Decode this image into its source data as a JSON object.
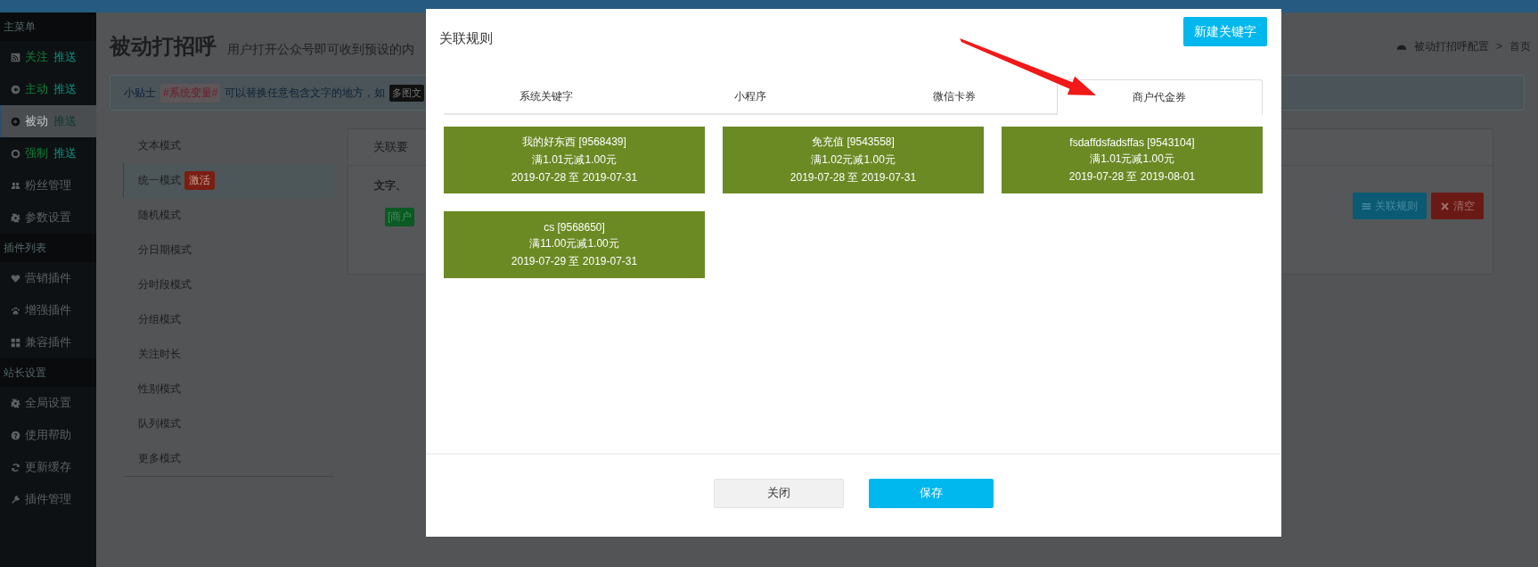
{
  "sidebar": {
    "sections": [
      {
        "title": "主菜单",
        "items": [
          {
            "label": "关注",
            "tag": "推送",
            "selected": false
          },
          {
            "label": "主动",
            "tag": "推送",
            "selected": false
          },
          {
            "label": "被动",
            "tag": "推送",
            "selected": true
          },
          {
            "label": "强制",
            "tag": "推送",
            "selected": false
          },
          {
            "label": "粉丝管理",
            "selected": false
          },
          {
            "label": "参数设置",
            "selected": false
          }
        ]
      },
      {
        "title": "插件列表",
        "items": [
          {
            "label": "营销插件",
            "selected": false
          },
          {
            "label": "增强插件",
            "selected": false
          },
          {
            "label": "兼容插件",
            "selected": false
          }
        ]
      },
      {
        "title": "站长设置",
        "items": [
          {
            "label": "全局设置",
            "selected": false
          },
          {
            "label": "使用帮助",
            "selected": false
          },
          {
            "label": "更新缓存",
            "selected": false
          },
          {
            "label": "插件管理",
            "selected": false
          }
        ]
      }
    ]
  },
  "page": {
    "title": "被动打招呼",
    "subtitle": "用户打开公众号即可收到预设的内",
    "breadcrumb": [
      "被动打招呼配置",
      ">",
      "首页"
    ]
  },
  "tip": {
    "label": "小贴士",
    "variable": "#系统变量#",
    "text": "可以替换任意包含文字的地方，如",
    "badge": "多图文"
  },
  "modes": [
    {
      "label": "文本模式",
      "selected": false
    },
    {
      "label": "统一模式",
      "badge": "激活",
      "selected": true
    },
    {
      "label": "随机模式",
      "selected": false
    },
    {
      "label": "分日期模式",
      "selected": false
    },
    {
      "label": "分时段模式",
      "selected": false
    },
    {
      "label": "分组模式",
      "selected": false
    },
    {
      "label": "关注时长",
      "selected": false
    },
    {
      "label": "性别模式",
      "selected": false
    },
    {
      "label": "队列模式",
      "selected": false
    },
    {
      "label": "更多模式",
      "selected": false
    }
  ],
  "panel": {
    "tab": "关联要",
    "text": "文字、",
    "tag": "[商户",
    "buttons": [
      {
        "label": "关联规则",
        "kind": "primary"
      },
      {
        "label": "清空",
        "kind": "danger"
      }
    ]
  },
  "modal": {
    "title": "关联规则",
    "new_button": "新建关键字",
    "tabs": [
      {
        "label": "系统关键字",
        "selected": false
      },
      {
        "label": "小程序",
        "selected": false
      },
      {
        "label": "微信卡券",
        "selected": false
      },
      {
        "label": "商户代金券",
        "selected": true
      }
    ],
    "coupons": [
      {
        "name": "我的好东西 [9568439]",
        "rule": "满1.01元减1.00元",
        "period": "2019-07-28 至 2019-07-31"
      },
      {
        "name": "免充值 [9543558]",
        "rule": "满1.02元减1.00元",
        "period": "2019-07-28 至 2019-07-31"
      },
      {
        "name": "fsdaffdsfadsffas [9543104]",
        "rule": "满1.01元减1.00元",
        "period": "2019-07-28 至 2019-08-01"
      },
      {
        "name": "cs [9568650]",
        "rule": "满11.00元减1.00元",
        "period": "2019-07-29 至 2019-07-31"
      }
    ],
    "buttons": [
      {
        "label": "关闭",
        "kind": "default"
      },
      {
        "label": "保存",
        "kind": "primary"
      }
    ]
  }
}
